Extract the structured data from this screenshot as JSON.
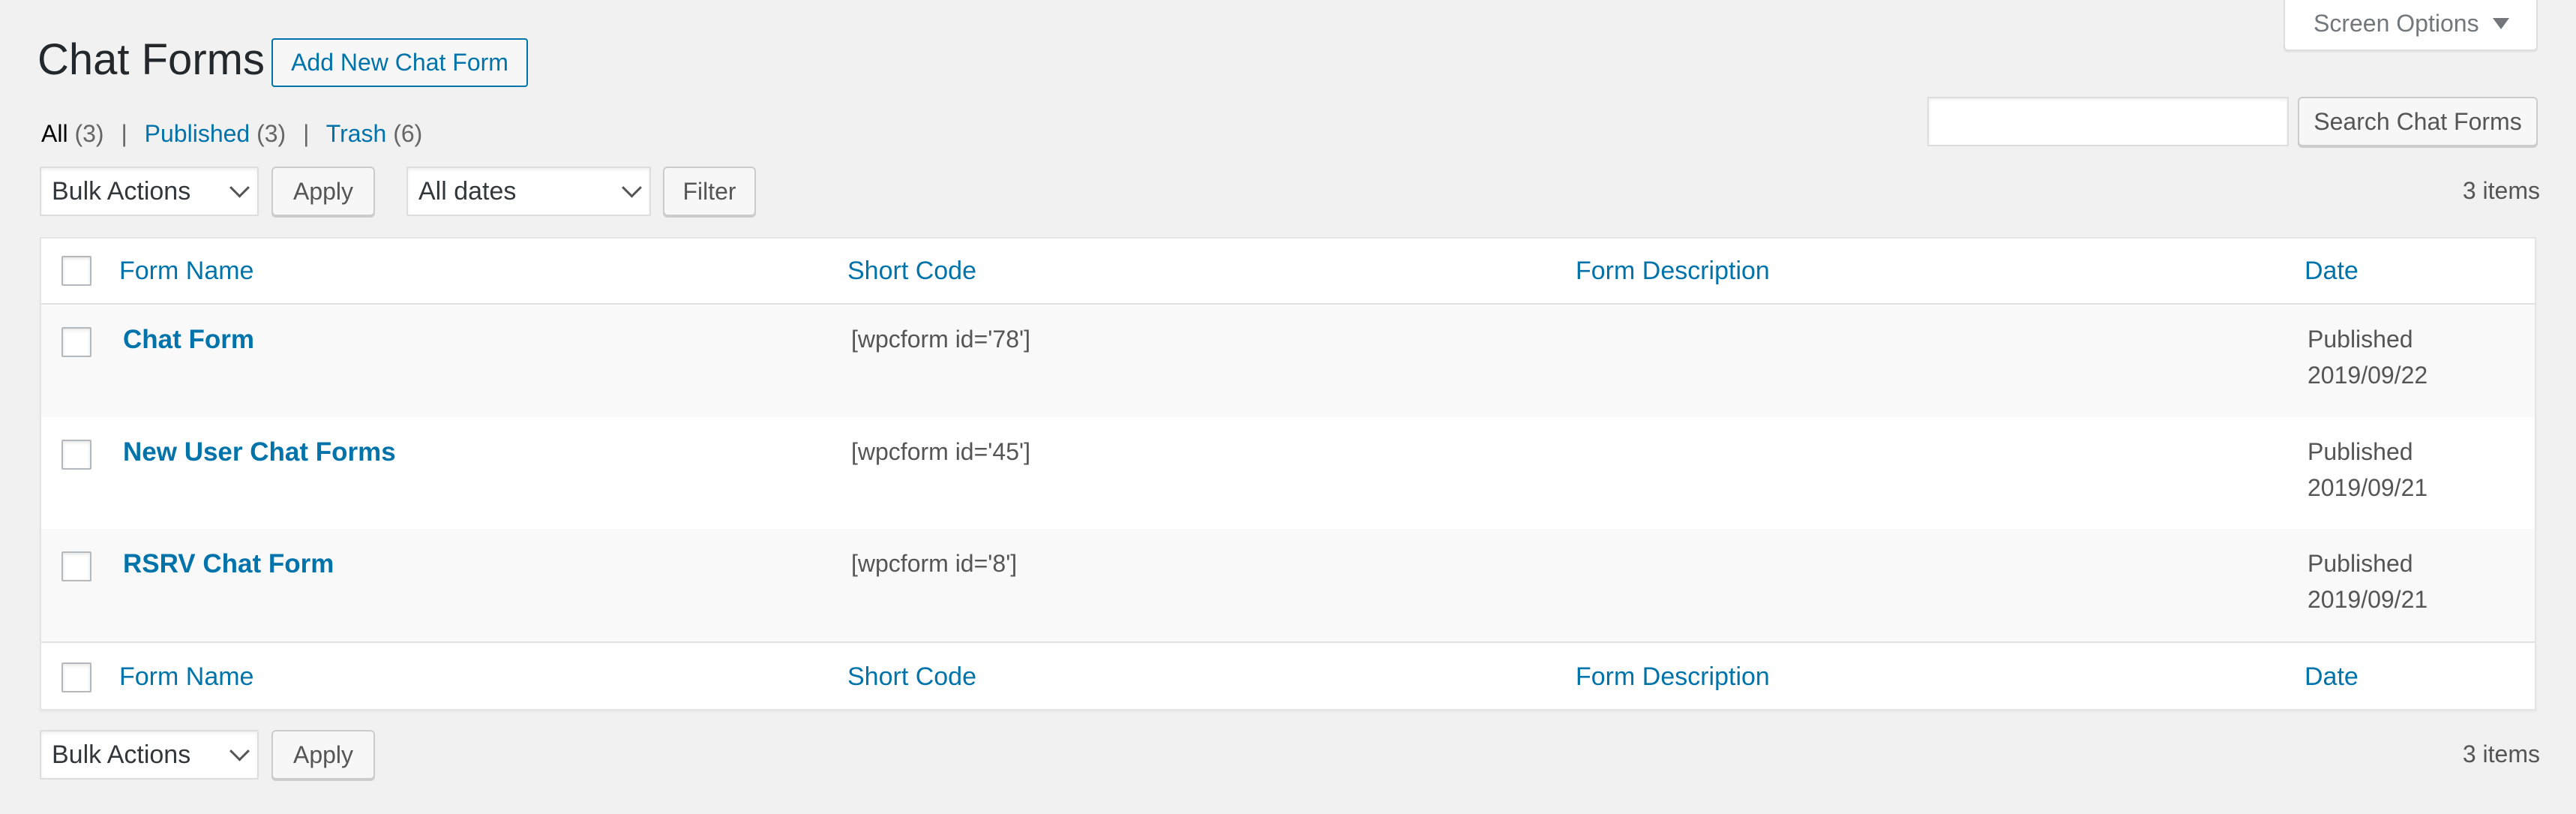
{
  "page": {
    "title": "Chat Forms",
    "add_new_label": "Add New Chat Form",
    "screen_options_label": "Screen Options"
  },
  "filters": {
    "all_label": "All",
    "all_count": "(3)",
    "published_label": "Published",
    "published_count": "(3)",
    "trash_label": "Trash",
    "trash_count": "(6)",
    "separator": "|"
  },
  "search": {
    "value": "",
    "button_label": "Search Chat Forms"
  },
  "tablenav_top": {
    "bulk_actions_selected": "Bulk Actions",
    "apply_label": "Apply",
    "dates_selected": "All dates",
    "filter_label": "Filter",
    "items_count": "3 items"
  },
  "tablenav_bottom": {
    "bulk_actions_selected": "Bulk Actions",
    "apply_label": "Apply",
    "items_count": "3 items"
  },
  "table": {
    "columns": [
      "Form Name",
      "Short Code",
      "Form Description",
      "Date"
    ],
    "rows": [
      {
        "name": "Chat Form",
        "shortcode": "[wpcform id='78']",
        "description": "",
        "status": "Published",
        "date": "2019/09/22"
      },
      {
        "name": "New User Chat Forms",
        "shortcode": "[wpcform id='45']",
        "description": "",
        "status": "Published",
        "date": "2019/09/21"
      },
      {
        "name": "RSRV Chat Form",
        "shortcode": "[wpcform id='8']",
        "description": "",
        "status": "Published",
        "date": "2019/09/21"
      }
    ]
  },
  "colors": {
    "link": "#0073aa",
    "background": "#f1f1f1",
    "row_alt": "#f9f9f9"
  }
}
